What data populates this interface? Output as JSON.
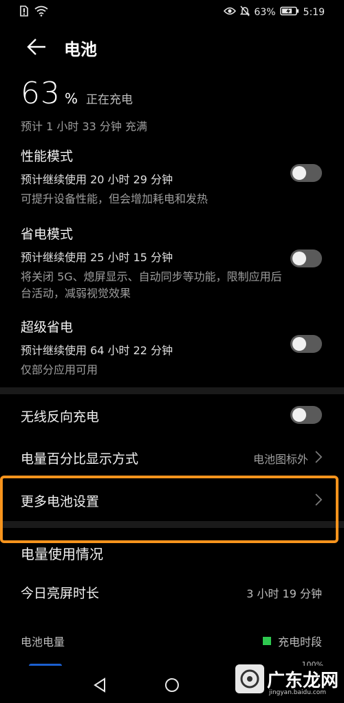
{
  "status_bar": {
    "battery_percent": "63%",
    "time": "5:19"
  },
  "header": {
    "title": "电池"
  },
  "battery": {
    "percent": "63",
    "percent_sign": "%",
    "charging_status": "正在充电",
    "estimate": "预计 1 小时 33 分钟 充满"
  },
  "modes": [
    {
      "title": "性能模式",
      "remaining": "预计继续使用 20 小时 29 分钟",
      "description": "可提升设备性能，但会增加耗电和发热",
      "enabled": false
    },
    {
      "title": "省电模式",
      "remaining": "预计继续使用 25 小时 15 分钟",
      "description": "将关闭 5G、熄屏显示、自动同步等功能，限制应用后台活动，减弱视觉效果",
      "enabled": false
    },
    {
      "title": "超级省电",
      "remaining": "预计继续使用 64 小时 22 分钟",
      "description": "仅部分应用可用",
      "enabled": false
    }
  ],
  "settings": {
    "wireless_reverse": {
      "label": "无线反向充电",
      "enabled": false
    },
    "percent_display": {
      "label": "电量百分比显示方式",
      "value": "电池图标外"
    },
    "more_settings": {
      "label": "更多电池设置"
    }
  },
  "usage": {
    "section_title": "电量使用情况",
    "screen_time_label": "今日亮屏时长",
    "screen_time_value": "3 小时 19 分钟",
    "chart_label": "电池电量",
    "legend_label": "充电时段",
    "axis_max": "100%"
  },
  "watermark": {
    "text": "广东龙网",
    "url": "jingyan.baidu.com"
  },
  "colors": {
    "background": "#000000",
    "highlight": "#f7941d",
    "charging_legend": "#2ec84f",
    "toggle_off": "#5a5a5a"
  }
}
